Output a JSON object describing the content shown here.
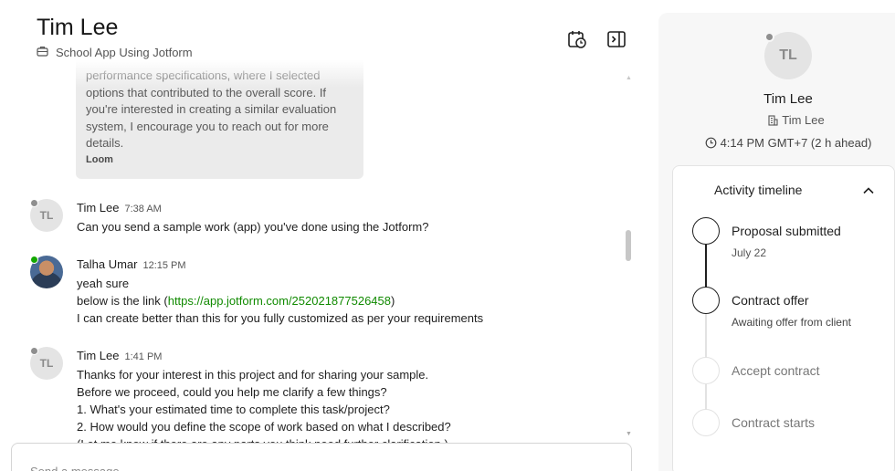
{
  "header": {
    "name": "Tim Lee",
    "project": "School App Using Jotform",
    "icons": [
      "briefcase-icon",
      "calendar-clock-icon",
      "sidebar-toggle-icon"
    ]
  },
  "quote": {
    "lines": [
      "performance specifications, where I selected",
      "options that contributed to the overall score. If",
      "you're interested in creating a similar evaluation",
      "system, I encourage you to reach out for more",
      "details."
    ],
    "source": "Loom"
  },
  "messages": [
    {
      "sender": "Tim Lee",
      "initials": "TL",
      "time": "7:38 AM",
      "lines": [
        "Can you send a sample work (app) you've done using the Jotform?"
      ]
    },
    {
      "sender": "Talha Umar",
      "time": "12:15 PM",
      "line1": "yeah sure",
      "line2_prefix": "below is the link (",
      "link": "https://app.jotform.com/252021877526458",
      "line2_suffix": ")",
      "line3": "I can create better than this for you fully customized as per your requirements"
    },
    {
      "sender": "Tim Lee",
      "initials": "TL",
      "time": "1:41 PM",
      "lines": [
        "Thanks for your interest in this project and for sharing your sample.",
        "Before we proceed, could you help me clarify a few things?",
        "1. What's your estimated time to complete this task/project?",
        "2. How would you define the scope of work based on what I described?",
        "(Let me know if there are any parts you think need further clarification.)"
      ]
    }
  ],
  "composer": {
    "placeholder": "Send a message"
  },
  "profile": {
    "initials": "TL",
    "name": "Tim Lee",
    "company": "Tim Lee",
    "local_time": "4:14 PM GMT+7 (2 h ahead)"
  },
  "timeline": {
    "title": "Activity timeline",
    "steps": [
      {
        "label": "Proposal submitted",
        "sub": "July 22",
        "status": "done"
      },
      {
        "label": "Contract offer",
        "sub": "Awaiting offer from client",
        "status": "current"
      },
      {
        "label": "Accept contract",
        "sub": "",
        "status": "pending"
      },
      {
        "label": "Contract starts",
        "sub": "",
        "status": "pending"
      }
    ]
  },
  "colors": {
    "link": "#108a00",
    "online": "#14a800",
    "offline": "#8f8f8f",
    "panel_bg": "#f7f7f7"
  }
}
